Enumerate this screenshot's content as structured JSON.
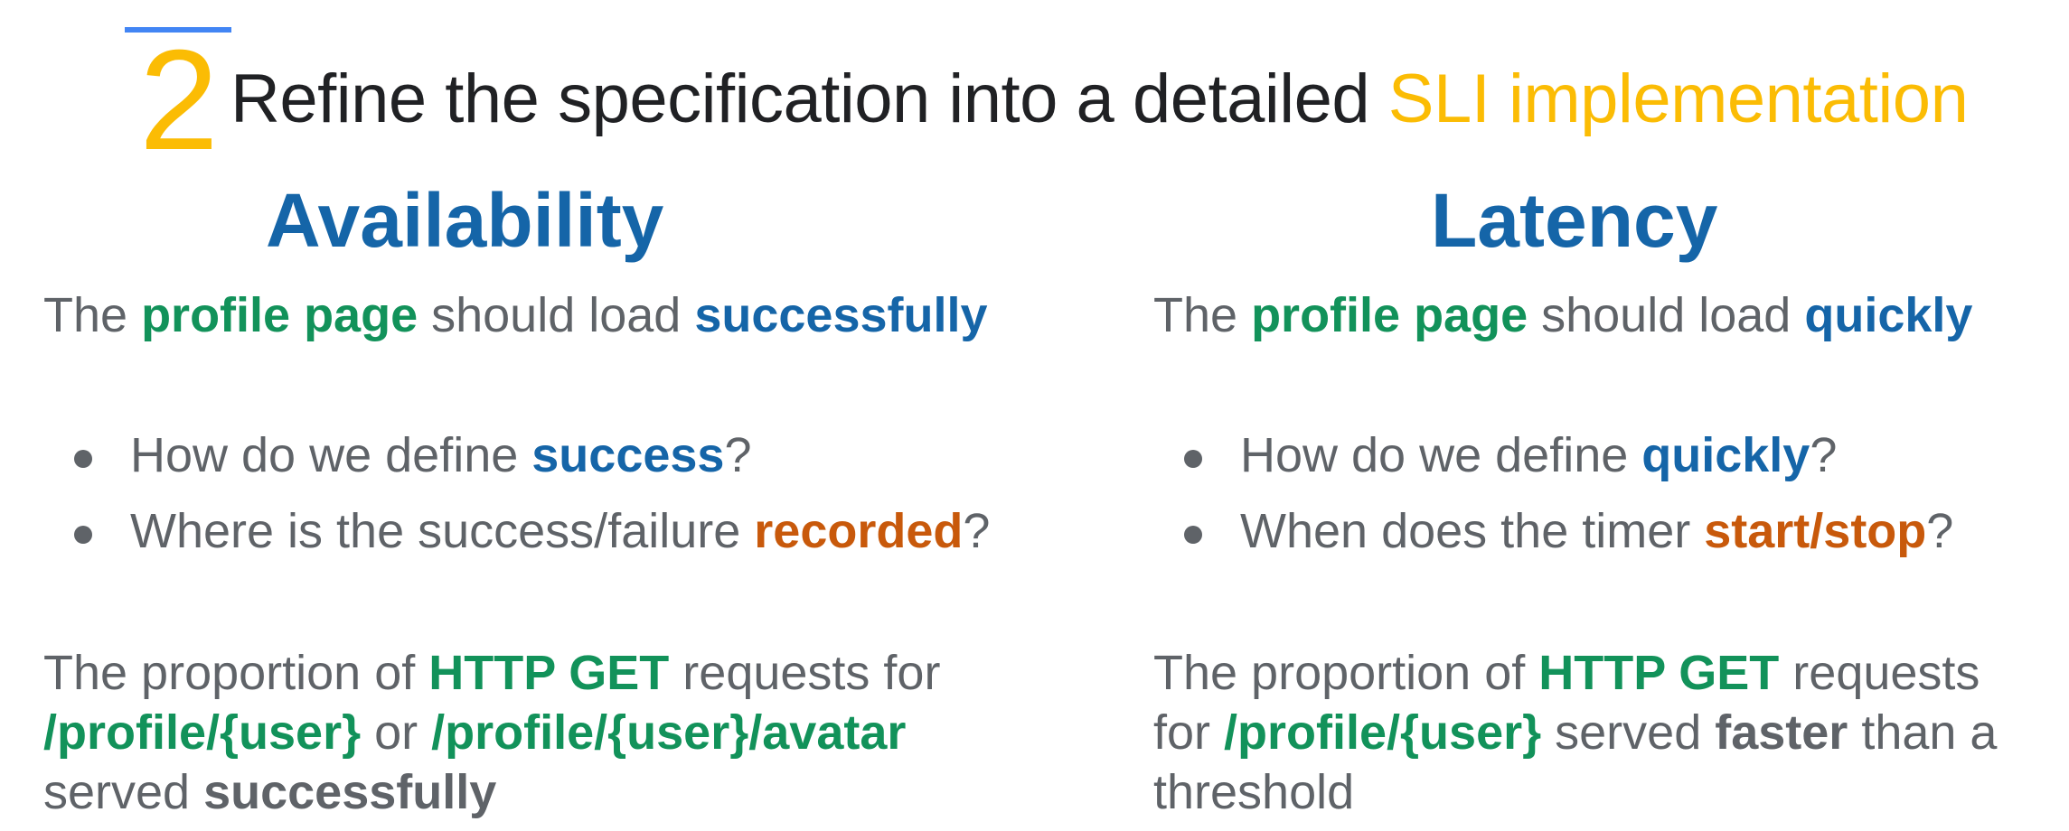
{
  "header": {
    "number": "2",
    "title_prefix": "Refine the specification into a detailed ",
    "title_highlight": "SLI implementation"
  },
  "colors": {
    "accent_yellow": "#fbbc04",
    "accent_blue_line": "#4285f4",
    "heading_blue": "#1565a8",
    "green": "#12925a",
    "orange": "#c8590b",
    "body_gray": "#5f6368"
  },
  "availability": {
    "heading": "Availability",
    "statement": {
      "t1": "The ",
      "subject": "profile page",
      "t2": " should load ",
      "quality": "successfully"
    },
    "bullets": [
      {
        "pre": "How do we define ",
        "key": "success",
        "post": "?"
      },
      {
        "pre": "Where is the success/failure ",
        "key": "recorded",
        "post": "?"
      }
    ],
    "definition": {
      "l1_pre": "The proportion of ",
      "l1_key": "HTTP GET",
      "l1_post": " requests for",
      "l2_path1": "/profile/{user}",
      "l2_mid": " or ",
      "l2_path2": "/profile/{user}/avatar",
      "l3_pre": "served ",
      "l3_key": "successfully"
    }
  },
  "latency": {
    "heading": "Latency",
    "statement": {
      "t1": "The ",
      "subject": "profile page",
      "t2": " should load ",
      "quality": "quickly"
    },
    "bullets": [
      {
        "pre": "How do we define ",
        "key": "quickly",
        "post": "?"
      },
      {
        "pre": "When does the timer ",
        "key": "start/stop",
        "post": "?"
      }
    ],
    "definition": {
      "l1_pre": "The proportion of ",
      "l1_key": "HTTP GET",
      "l1_post": " requests",
      "l2_pre": "for ",
      "l2_path": "/profile/{user}",
      "l2_mid": " served ",
      "l2_key": "faster",
      "l2_post": " than a",
      "l3": "threshold"
    }
  }
}
